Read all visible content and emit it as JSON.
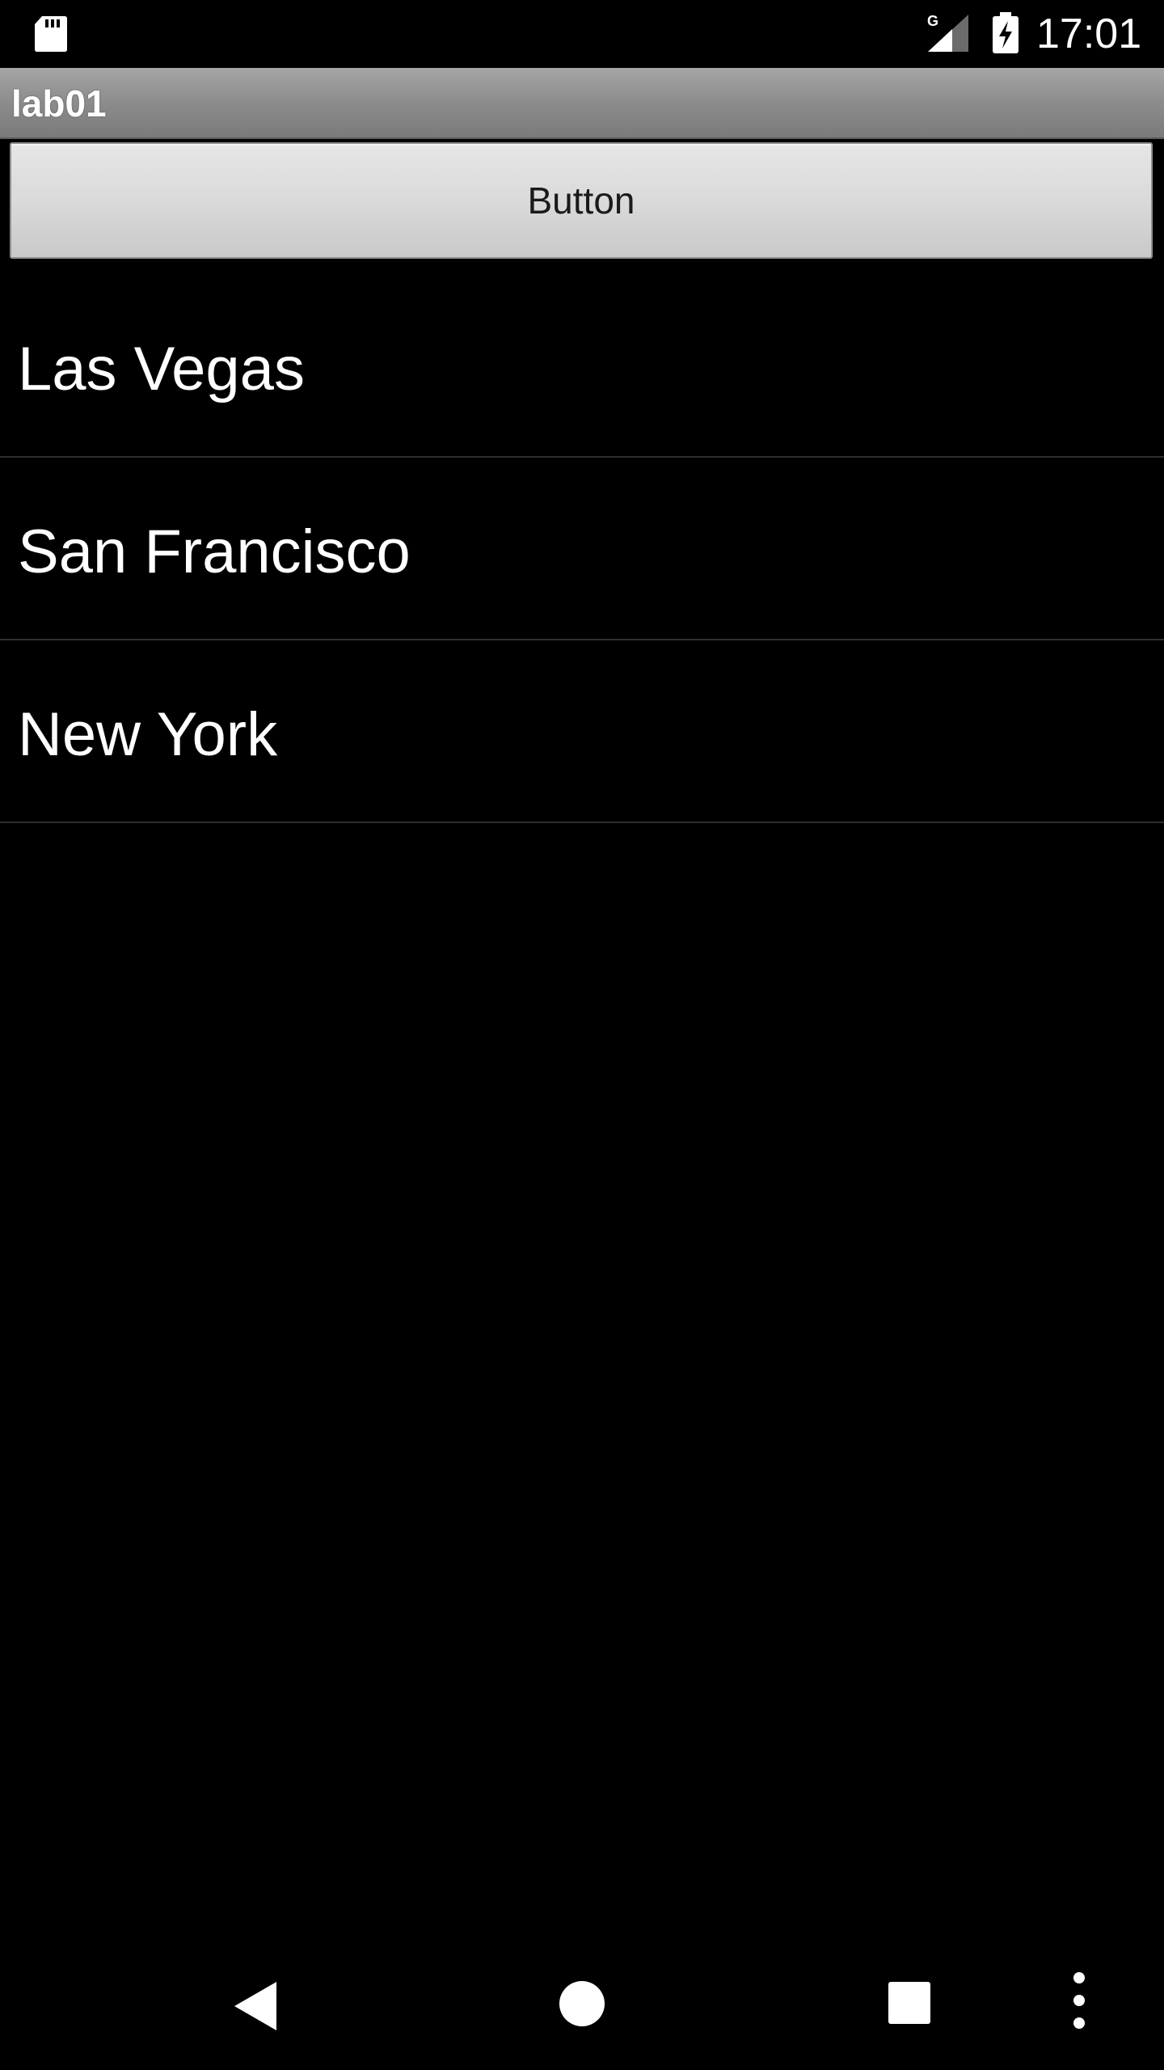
{
  "status_bar": {
    "time": "17:01",
    "network_type": "G",
    "icons": [
      "sd-card-icon",
      "signal-icon",
      "battery-charging-icon"
    ]
  },
  "app": {
    "title": "lab01"
  },
  "button": {
    "label": "Button"
  },
  "list": {
    "items": [
      {
        "label": "Las Vegas"
      },
      {
        "label": "San Francisco"
      },
      {
        "label": "New York"
      }
    ]
  },
  "nav_bar": {
    "icons": [
      "back-icon",
      "home-icon",
      "recents-icon",
      "overflow-menu-icon"
    ]
  },
  "colors": {
    "background": "#000000",
    "title_bar": "#8e8e8e",
    "text": "#ffffff",
    "button_face": "#dadada",
    "divider": "#2f2f2f"
  }
}
